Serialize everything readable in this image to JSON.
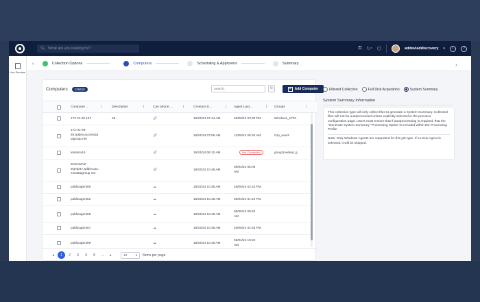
{
  "topbar": {
    "search_placeholder": "What are you looking for?",
    "username": "addevladdiscovery",
    "icons": [
      "key-icon",
      "refresh-status-icon",
      "cube-icon",
      "info-icon",
      "help-icon"
    ]
  },
  "rail": {
    "label": "Live Preview"
  },
  "stepper": {
    "steps": [
      {
        "label": "Collection Options",
        "state": "done",
        "color": "#3ec46d"
      },
      {
        "label": "Computers",
        "state": "active",
        "color": "#2f4fb0"
      },
      {
        "label": "Scheduling & Approvers",
        "state": "pending",
        "color": "#dfe2e8"
      },
      {
        "label": "Summary",
        "state": "pending",
        "color": "#dfe2e8"
      }
    ]
  },
  "table": {
    "title": "Computers",
    "count": "139415",
    "search_placeholder": "Search...",
    "add_label": "Add Computer",
    "columns": [
      "Computer ...",
      "Description",
      "Can phone ...",
      "Creation D...",
      "Agent Last...",
      "Groups"
    ],
    "rows": [
      {
        "name": [
          "172.31.20.167"
        ],
        "desc": "35",
        "phone": "link",
        "created": "15/04/24 07:44 AM",
        "agent": [
          "28/06/24 03:28 PM"
        ],
        "groups": "Windows_1704"
      },
      {
        "name": [
          "172-31-90-",
          "50.addev.accessda",
          "tagroup.net"
        ],
        "desc": "",
        "phone": "link",
        "created": "15/04/24 07:55 AM",
        "agent": [
          "12/06/24 06:34 AM"
        ],
        "groups": "Grp_new3"
      },
      {
        "name": [
          "testserv15"
        ],
        "desc": "",
        "phone": "link",
        "created": "15/04/24 08:10 AM",
        "agent_badge": "Not Connected",
        "groups": "group1venkat_g"
      },
      {
        "name": [
          "EC2AMAZ-",
          "9QHD47.addev.acc",
          "essdatagroup.net"
        ],
        "desc": "",
        "phone": "link",
        "created": "15/04/24 10:48 AM",
        "agent": [
          "06/04/24 05:09",
          "AM"
        ],
        "groups": ""
      },
      {
        "name": [
          "publicagent05"
        ],
        "desc": "",
        "phone": "cloud",
        "created": "15/04/24 10:48 AM",
        "agent": [
          "28/06/24 02:24 PM"
        ],
        "groups": ""
      },
      {
        "name": [
          "publicagent02"
        ],
        "desc": "",
        "phone": "cloud",
        "created": "15/04/24 10:48 AM",
        "agent": [
          "09/04/24 01:19 PM"
        ],
        "groups": ""
      },
      {
        "name": [
          "publicagent08"
        ],
        "desc": "",
        "phone": "cloud",
        "created": "15/04/24 10:48 AM",
        "agent": [
          "09/05/24 09:53",
          "AM"
        ],
        "groups": ""
      },
      {
        "name": [
          "publicagent07"
        ],
        "desc": "",
        "phone": "cloud",
        "created": "15/04/24 10:48 AM",
        "agent": [
          "28/06/24 02:25 PM"
        ],
        "groups": ""
      },
      {
        "name": [
          "publicagent09"
        ],
        "desc": "",
        "phone": "cloud",
        "created": "15/04/24 10:48 AM",
        "agent": [
          "02/04/24 10:24",
          "AM"
        ],
        "groups": ""
      }
    ],
    "pager": {
      "pages": [
        "1",
        "2",
        "3",
        "4",
        "5",
        "..."
      ],
      "per_page": "10",
      "per_page_label": "Items per page"
    }
  },
  "right": {
    "options": [
      {
        "label": "Filtered Collection",
        "selected": false
      },
      {
        "label": "Full Disk Acquisition",
        "selected": false
      },
      {
        "label": "System Summary",
        "selected": true
      }
    ],
    "section_title": "System Summary Information",
    "para1": "This collection type will only collect files to generate a System Summary. Collected files will not be autoprocessed unless explicitly selected in the previous configuration page. Users must ensure that if autoprocessing is required, that the \"Generate System Summary\" Processing Option is included within the Processing Profile",
    "para2": "Note: Only Windows Agents are supported for this job type. If a Linux Agent is selected, it will be skipped."
  }
}
